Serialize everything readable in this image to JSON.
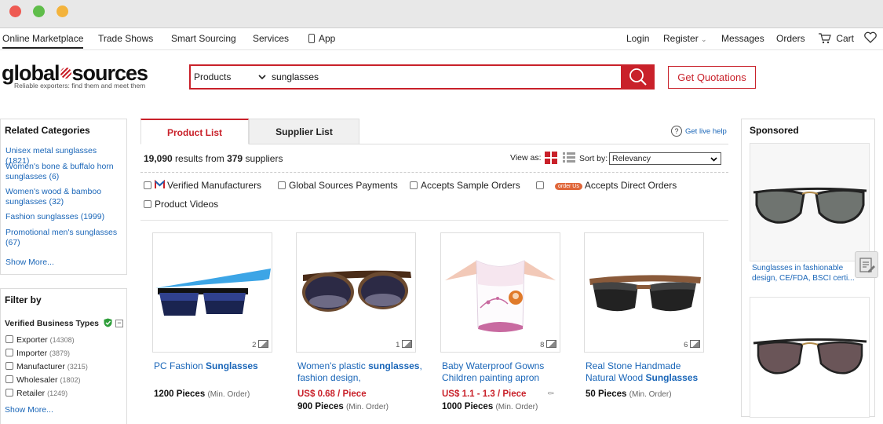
{
  "topnav": {
    "left": [
      "Online Marketplace",
      "Trade Shows",
      "Smart Sourcing",
      "Services",
      "App"
    ],
    "right": {
      "login": "Login",
      "register": "Register",
      "messages": "Messages",
      "orders": "Orders",
      "cart": "Cart"
    }
  },
  "header": {
    "logo_left": "global",
    "logo_right": "sources",
    "tagline": "Reliable exporters: find them and meet them",
    "category_select": "Products",
    "search_value": "sunglasses",
    "quote_button": "Get Quotations"
  },
  "related": {
    "title": "Related Categories",
    "items": [
      "Unisex metal sunglasses (1821)",
      "Women's bone & buffalo horn sunglasses (6)",
      "Women's wood & bamboo sunglasses (32)",
      "Fashion sunglasses (1999)",
      "Promotional men's sunglasses (67)"
    ],
    "show_more": "Show More..."
  },
  "filter": {
    "title": "Filter by",
    "section": "Verified Business Types",
    "items": [
      {
        "label": "Exporter",
        "count": "(14308)"
      },
      {
        "label": "Importer",
        "count": "(3879)"
      },
      {
        "label": "Manufacturer",
        "count": "(3215)"
      },
      {
        "label": "Wholesaler",
        "count": "(1802)"
      },
      {
        "label": "Retailer",
        "count": "(1249)"
      }
    ],
    "show_more": "Show More..."
  },
  "tabs": {
    "product": "Product List",
    "supplier": "Supplier List"
  },
  "live_help": "Get live help",
  "results": {
    "count": "19,090",
    "mid": "results from",
    "suppliers": "379",
    "tail": "suppliers"
  },
  "view_as": "View as:",
  "sort": {
    "label": "Sort by:",
    "value": "Relevancy"
  },
  "checks": {
    "verified": "Verified Manufacturers",
    "payments": "Global Sources Payments",
    "sample": "Accepts Sample Orders",
    "order_badge": "order Us",
    "direct": "Accepts Direct Orders",
    "videos": "Product Videos"
  },
  "products": [
    {
      "title_a": "PC Fashion ",
      "title_b": "Sunglasses",
      "title_c": "",
      "price": "",
      "moq": "1200 Pieces",
      "moq_note": "(Min. Order)",
      "img_count": "2"
    },
    {
      "title_a": "Women's plastic ",
      "title_b": "sunglasses",
      "title_c": ", fashion design,",
      "price": "US$ 0.68 / Piece",
      "moq": "900 Pieces",
      "moq_note": "(Min. Order)",
      "img_count": "1"
    },
    {
      "title_a": "Baby Waterproof Gowns Children painting apron",
      "title_b": "",
      "title_c": "",
      "price": "US$ 1.1 - 1.3 / Piece",
      "moq": "1000 Pieces",
      "moq_note": "(Min. Order)",
      "img_count": "8"
    },
    {
      "title_a": "Real Stone Handmade Natural Wood ",
      "title_b": "Sunglasses",
      "title_c": "",
      "price": "",
      "moq": "50 Pieces",
      "moq_note": "(Min. Order)",
      "img_count": "6"
    }
  ],
  "sponsored": {
    "title": "Sponsored",
    "caption": "Sunglasses in fashionable design, CE/FDA, BSCI certi..."
  },
  "colors": {
    "brand_red": "#c9212a",
    "link_blue": "#1a66b8",
    "verified_green": "#2e9e3a"
  }
}
